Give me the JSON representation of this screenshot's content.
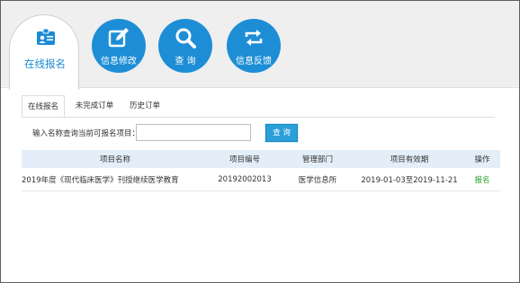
{
  "nav": {
    "active": {
      "label": "在线报名",
      "icon": "registration-badge-icon"
    },
    "buttons": [
      {
        "label": "信息修改",
        "icon": "edit-icon"
      },
      {
        "label": "查 询",
        "icon": "search-icon"
      },
      {
        "label": "信息反馈",
        "icon": "feedback-refresh-icon"
      }
    ]
  },
  "tabs": [
    {
      "label": "在线报名",
      "active": true
    },
    {
      "label": "未完成订单",
      "active": false
    },
    {
      "label": "历史订单",
      "active": false
    }
  ],
  "search": {
    "label": "输入名称查询当前可报名项目：",
    "value": "",
    "button_label": "查 询"
  },
  "table": {
    "headers": [
      "项目名称",
      "项目编号",
      "管理部门",
      "项目有效期",
      "操作"
    ],
    "rows": [
      {
        "name": "2019年度《现代临床医学》刊授继续医学教育",
        "code": "20192002013",
        "dept": "医学信息所",
        "period": "2019-01-03至2019-11-21",
        "action": "报名"
      }
    ]
  },
  "colors": {
    "accent": "#1d8ed6",
    "header_bg": "#e4eef8",
    "action_link": "#2aa32a",
    "topbar_bg": "#efefef"
  }
}
